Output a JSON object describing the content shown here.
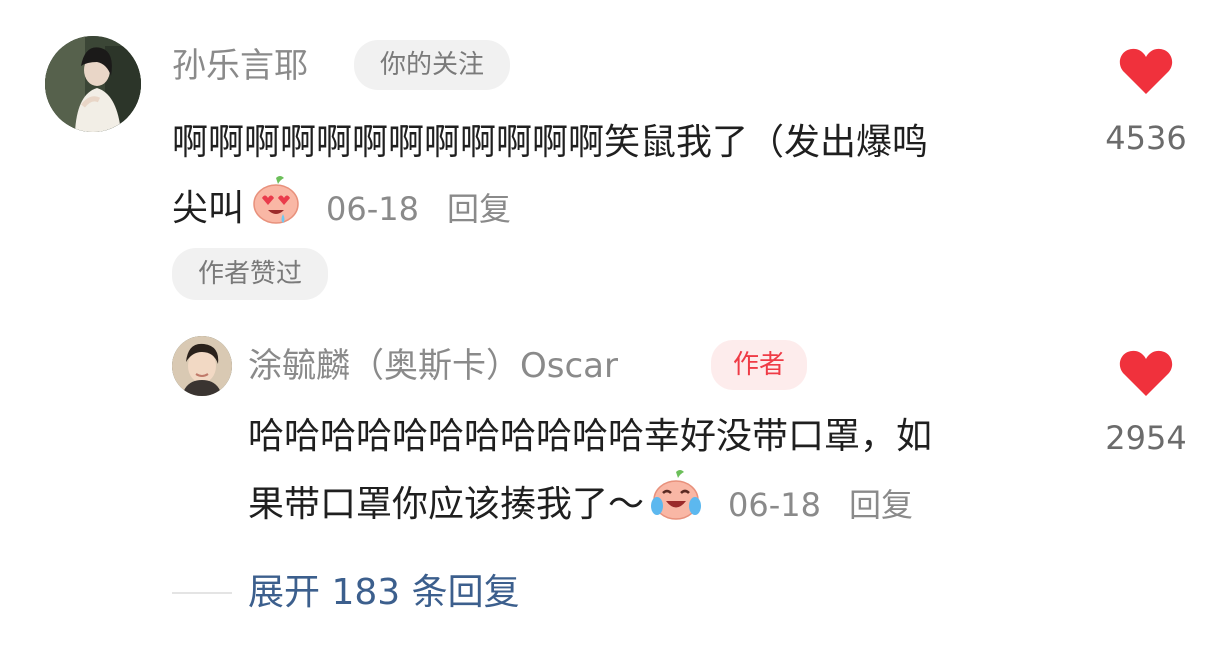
{
  "colors": {
    "like_heart": "#f0313c",
    "author_badge_text": "#ef3b46",
    "author_badge_bg": "#fdecec",
    "expand_link": "#3c5f8d",
    "muted_text": "#8a8a8a"
  },
  "comment": {
    "username": "孙乐言耶",
    "follow_tag": "你的关注",
    "text_line1": "啊啊啊啊啊啊啊啊啊啊啊啊笑鼠我了（发出爆鸣",
    "text_line2": "尖叫",
    "emoji_icon": "heart-eyes-peach-emoji",
    "date": "06-18",
    "reply_label": "回复",
    "author_liked_tag": "作者赞过",
    "like_icon": "heart-icon",
    "like_count": "4536"
  },
  "reply": {
    "username": "涂毓麟（奥斯卡）Oscar",
    "author_tag": "作者",
    "text_line1": "哈哈哈哈哈哈哈哈哈哈哈幸好没带口罩，如",
    "text_line2": "果带口罩你应该揍我了～",
    "emoji_icon": "crying-laughing-peach-emoji",
    "date": "06-18",
    "reply_label": "回复",
    "like_icon": "heart-icon",
    "like_count": "2954"
  },
  "expand": {
    "label": "展开 183 条回复"
  }
}
